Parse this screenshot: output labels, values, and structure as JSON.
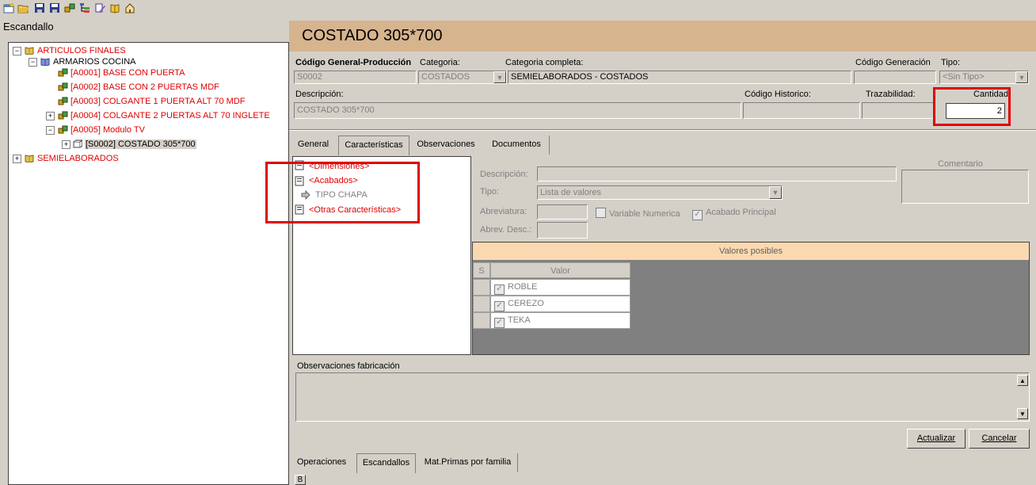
{
  "toolbar": {
    "icons": [
      "new-icon",
      "open-icon",
      "save-icon",
      "save-as-icon",
      "structure-icon",
      "tree-icon",
      "edit-icon",
      "book-icon",
      "home-icon"
    ]
  },
  "left_panel": {
    "title": "Escandallo",
    "tree": [
      {
        "label": "ARTICULOS FINALES"
      },
      {
        "label": "ARMARIOS COCINA"
      },
      {
        "label": "[A0001] BASE CON PUERTA"
      },
      {
        "label": "[A0002] BASE CON 2 PUERTAS MDF"
      },
      {
        "label": "[A0003] COLGANTE 1 PUERTA ALT 70 MDF"
      },
      {
        "label": "[A0004] COLGANTE 2 PUERTAS ALT 70 INGLETE"
      },
      {
        "label": "[A0005] Modulo TV"
      },
      {
        "label": "[S0002] COSTADO 305*700"
      },
      {
        "label": "SEMIELABORADOS"
      }
    ]
  },
  "header": {
    "title": "COSTADO 305*700"
  },
  "form": {
    "codigo_general_label": "Código General-Producción",
    "codigo_general_value": "S0002",
    "categoria_label": "Categoria:",
    "categoria_value": "COSTADOS",
    "categoria_completa_label": "Categoria completa:",
    "categoria_completa_value": "SEMIELABORADOS - COSTADOS",
    "codigo_generacion_label": "Código Generación",
    "tipo_label": "Tipo:",
    "tipo_value": "<Sin Tipo>",
    "descripcion_label": "Descripción:",
    "descripcion_value": "COSTADO 305*700",
    "codigo_historico_label": "Código Historico:",
    "trazabilidad_label": "Trazabilidad:",
    "cantidad_label": "Cantidad:",
    "cantidad_value": "2"
  },
  "tabs": [
    "General",
    "Características",
    "Observaciones",
    "Documentos"
  ],
  "caracteristicas": {
    "list": {
      "dimensiones": "<Dimensiones>",
      "acabados": "<Acabados>",
      "tipo_chapa": "TIPO CHAPA",
      "otras": "<Otras Características>"
    },
    "descripcion_label": "Descripción:",
    "tipo_label": "Tipo:",
    "tipo_value": "Lista de valores",
    "abreviatura_label": "Abreviatura:",
    "abrev_desc_label": "Abrev. Desc.:",
    "variable_numerica_label": "Variable Numerica",
    "acabado_principal_label": "Acabado Principal",
    "comentario_label": "Comentario",
    "valores_title": "Valores posibles",
    "grid_headers": {
      "s": "S",
      "valor": "Valor"
    },
    "values": [
      "ROBLE",
      "CEREZO",
      "TEKA"
    ]
  },
  "observaciones": {
    "label": "Observaciones fabricación"
  },
  "buttons": {
    "actualizar": "Actualizar",
    "cancelar": "Cancelar"
  },
  "bottom_tabs": [
    "Operaciones",
    "Escandallos",
    "Mat.Primas por familia"
  ],
  "bottom_button": "B",
  "colors": {
    "header_bg": "#d6b48e",
    "highlight_red": "#e00000",
    "values_header_bg": "#fbd9b0"
  }
}
